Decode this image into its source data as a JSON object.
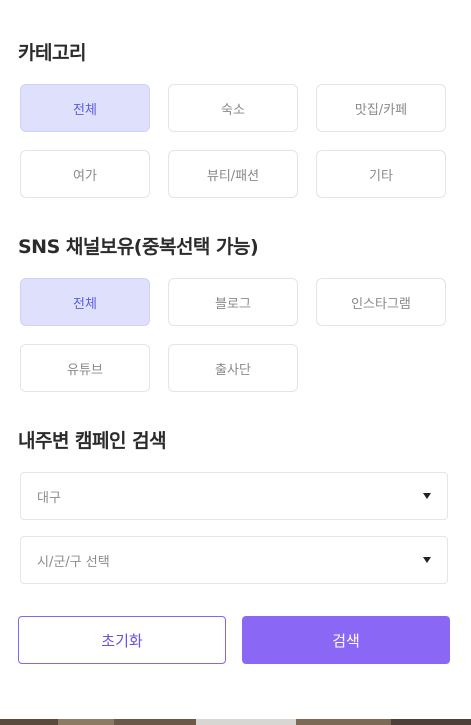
{
  "category": {
    "title": "카테고리",
    "options": [
      {
        "label": "전체",
        "selected": true
      },
      {
        "label": "숙소",
        "selected": false
      },
      {
        "label": "맛집/카페",
        "selected": false
      },
      {
        "label": "여가",
        "selected": false
      },
      {
        "label": "뷰티/패션",
        "selected": false
      },
      {
        "label": "기타",
        "selected": false
      }
    ]
  },
  "sns": {
    "title": "SNS 채널보유(중복선택 가능)",
    "options": [
      {
        "label": "전체",
        "selected": true
      },
      {
        "label": "블로그",
        "selected": false
      },
      {
        "label": "인스타그램",
        "selected": false
      },
      {
        "label": "유튜브",
        "selected": false
      },
      {
        "label": "출사단",
        "selected": false
      }
    ]
  },
  "nearby": {
    "title": "내주변 캠페인 검색",
    "region_select": {
      "value": "대구"
    },
    "district_select": {
      "value": "시/군/구 선택"
    }
  },
  "actions": {
    "reset_label": "초기화",
    "search_label": "검색"
  },
  "colors": {
    "accent": "#8a68f5",
    "chip_selected_bg": "#dfe0fb",
    "chip_selected_text": "#5b5fd6"
  }
}
